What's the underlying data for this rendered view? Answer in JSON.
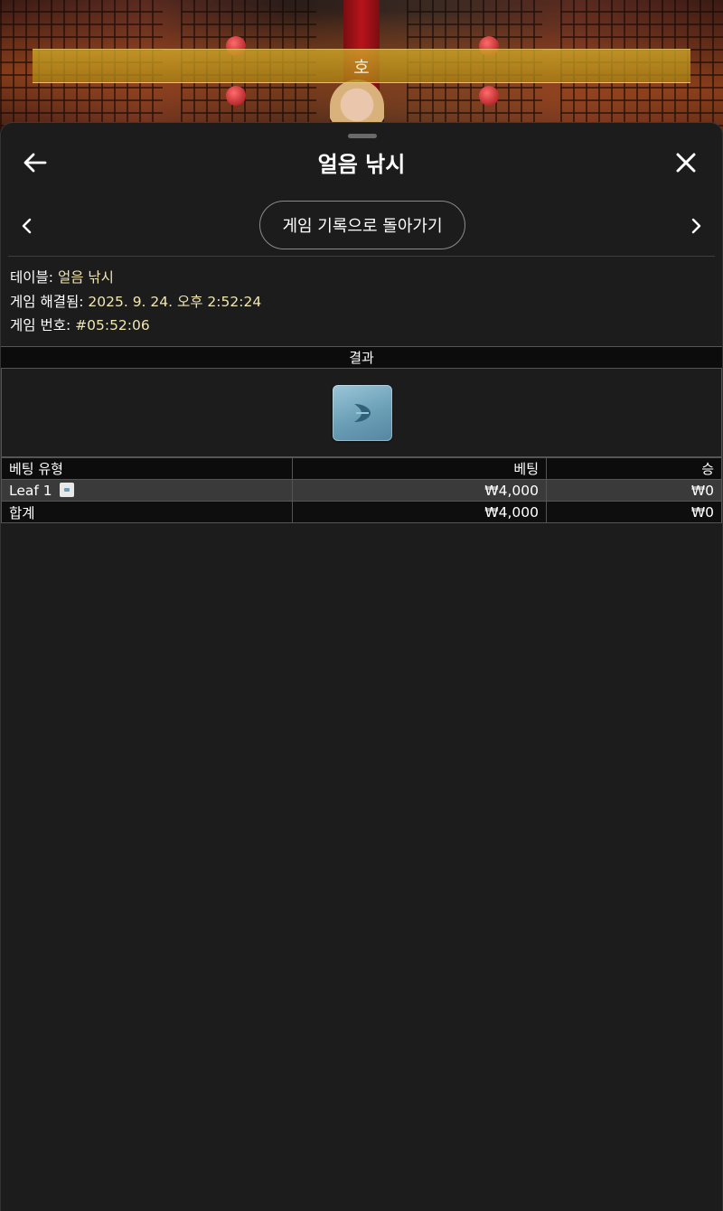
{
  "stage": {
    "banner_text": "호"
  },
  "sheet": {
    "title": "얼음 낚시",
    "back_icon": "arrow-left-icon",
    "close_icon": "close-icon",
    "prev_icon": "chevron-left-icon",
    "next_icon": "chevron-right-icon",
    "back_to_history_label": "게임 기록으로 돌아가기"
  },
  "info": {
    "table_label": "테이블:",
    "table_value": "얼음 낚시",
    "resolved_label": "게임 해결됨:",
    "resolved_value": "2025. 9. 24. 오후 2:52:24",
    "game_no_label": "게임 번호:",
    "game_no_value": "#05:52:06"
  },
  "results": {
    "header": "결과",
    "result_icon": "leaf-tile-icon"
  },
  "bets": {
    "columns": [
      "베팅 유형",
      "베팅",
      "승"
    ],
    "rows": [
      {
        "type": "Leaf 1",
        "bet": "₩4,000",
        "win": "₩0"
      }
    ],
    "total": {
      "type": "합계",
      "bet": "₩4,000",
      "win": "₩0"
    }
  },
  "colors": {
    "accent_text": "#f1e6b0",
    "sheet_bg": "#1c1c1c",
    "banner": "#c9a328",
    "leaf_tile": "#6a9fb6"
  }
}
